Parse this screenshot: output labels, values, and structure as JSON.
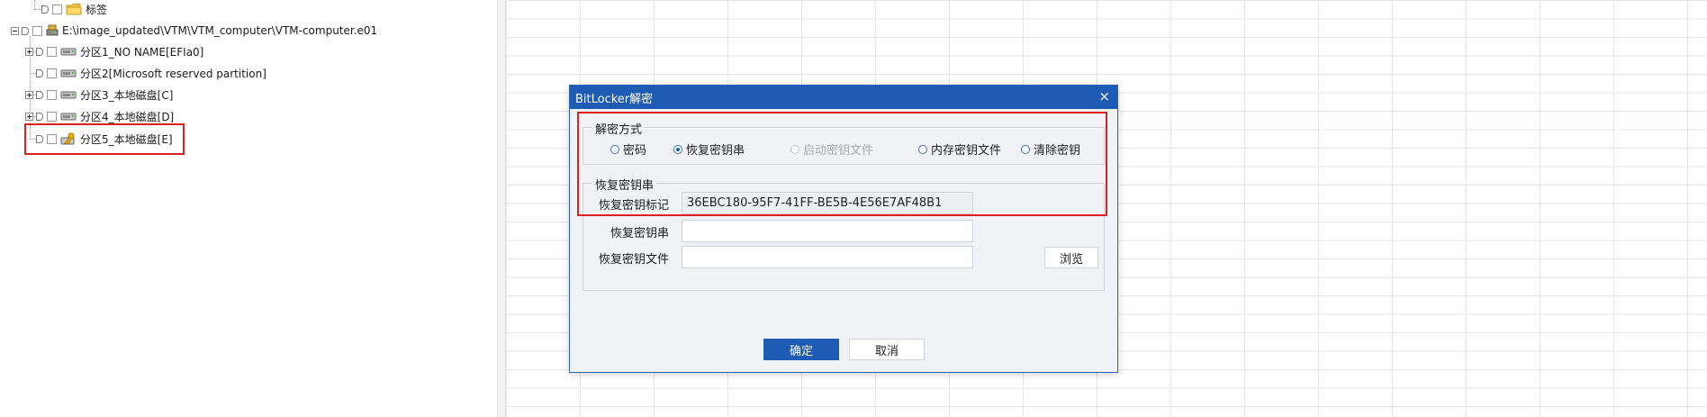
{
  "tree": {
    "nodes": [
      {
        "label": "标签",
        "icon": "folder-icon"
      },
      {
        "label": "E:\\image_updated\\VTM\\VTM_computer\\VTM-computer.e01",
        "icon": "evidence-image-icon"
      },
      {
        "label": "分区1_NO NAME[EFIa0]",
        "icon": "partition-icon"
      },
      {
        "label": "分区2[Microsoft reserved partition]",
        "icon": "partition-icon"
      },
      {
        "label": "分区3_本地磁盘[C]",
        "icon": "partition-icon"
      },
      {
        "label": "分区4_本地磁盘[D]",
        "icon": "partition-icon"
      },
      {
        "label": "分区5_本地磁盘[E]",
        "icon": "locked-partition-key-icon"
      }
    ]
  },
  "dialog": {
    "title": "BitLocker解密",
    "close": "×",
    "method_group_title": "解密方式",
    "methods": [
      {
        "label": "密码",
        "selected": false,
        "enabled": true
      },
      {
        "label": "恢复密钥串",
        "selected": true,
        "enabled": true
      },
      {
        "label": "启动密钥文件",
        "selected": false,
        "enabled": false
      },
      {
        "label": "内存密钥文件",
        "selected": false,
        "enabled": true
      },
      {
        "label": "清除密钥",
        "selected": false,
        "enabled": true
      }
    ],
    "recovery_group_title": "恢复密钥串",
    "key_id_label": "恢复密钥标记",
    "key_id_value": "36EBC180-95F7-41FF-BE5B-4E56E7AF48B1",
    "key_string_label": "恢复密钥串",
    "key_string_value": "",
    "key_file_label": "恢复密钥文件",
    "key_file_value": "",
    "browse": "浏览",
    "ok": "确定",
    "cancel": "取消"
  },
  "colors": {
    "accent": "#1d5bb5",
    "highlight": "#e02020"
  }
}
